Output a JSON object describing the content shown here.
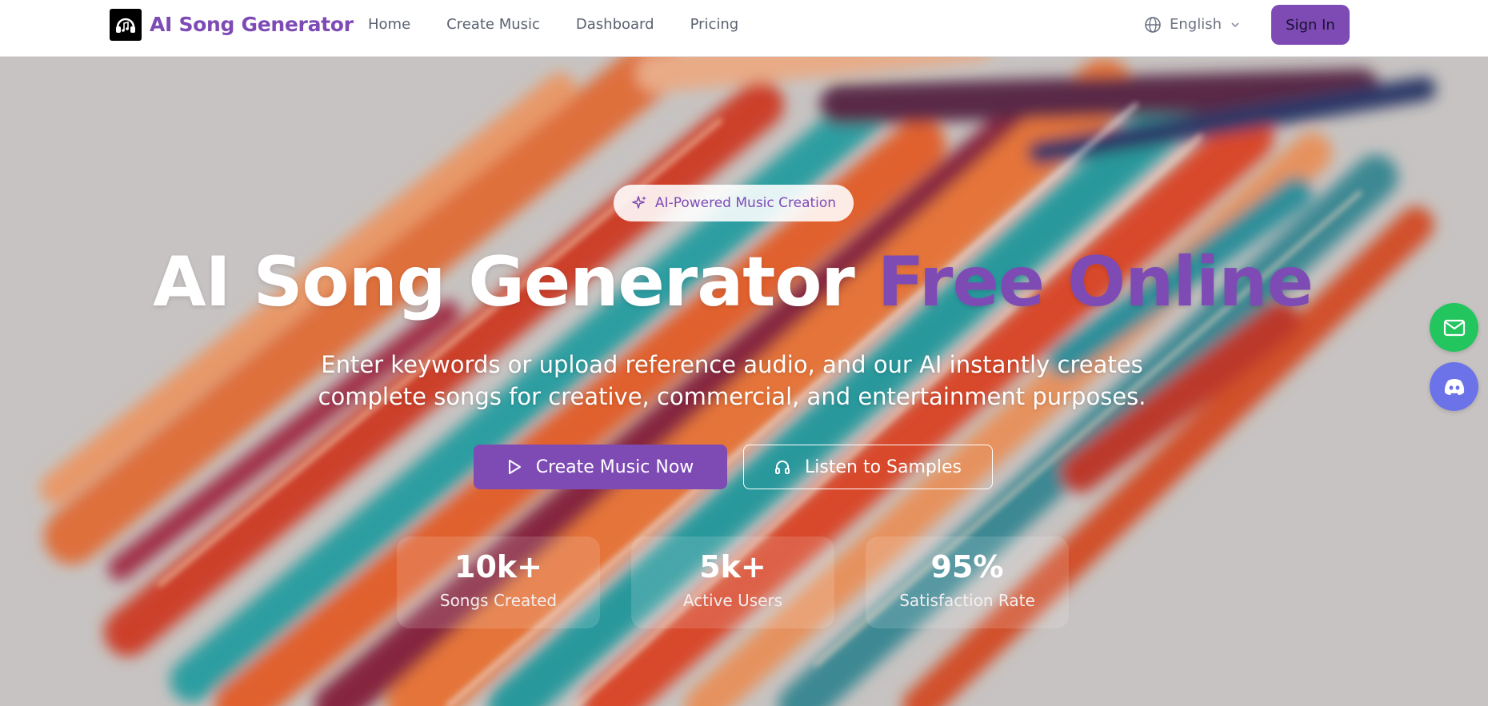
{
  "header": {
    "brand": "AI Song Generator",
    "nav": [
      "Home",
      "Create Music",
      "Dashboard",
      "Pricing"
    ],
    "language": "English",
    "signin_label": "Sign In"
  },
  "hero": {
    "badge": "AI-Powered Music Creation",
    "title_main": "AI Song Generator",
    "title_accent": "Free Online",
    "subtitle_line1": "Enter keywords or upload reference audio, and our AI instantly creates",
    "subtitle_line2": "complete songs for creative, commercial, and entertainment purposes.",
    "primary_button": "Create Music Now",
    "secondary_button": "Listen to Samples",
    "stats": [
      {
        "value": "10k+",
        "label": "Songs Created"
      },
      {
        "value": "5k+",
        "label": "Active Users"
      },
      {
        "value": "95%",
        "label": "Satisfaction Rate"
      }
    ]
  },
  "icons": {
    "logo": "headphones-music-icon",
    "language": "globe-icon",
    "dropdown": "chevron-down-icon",
    "badge": "sparkles-icon",
    "primary_button": "play-icon",
    "secondary_button": "headphones-icon",
    "fab_mail": "mail-icon",
    "fab_discord": "discord-icon"
  },
  "colors": {
    "accent": "#7e4bb5",
    "header_bg": "#ffffff",
    "nav_text": "#5a6170",
    "mail_button": "#22c55e",
    "discord_button": "#6c72e8"
  }
}
